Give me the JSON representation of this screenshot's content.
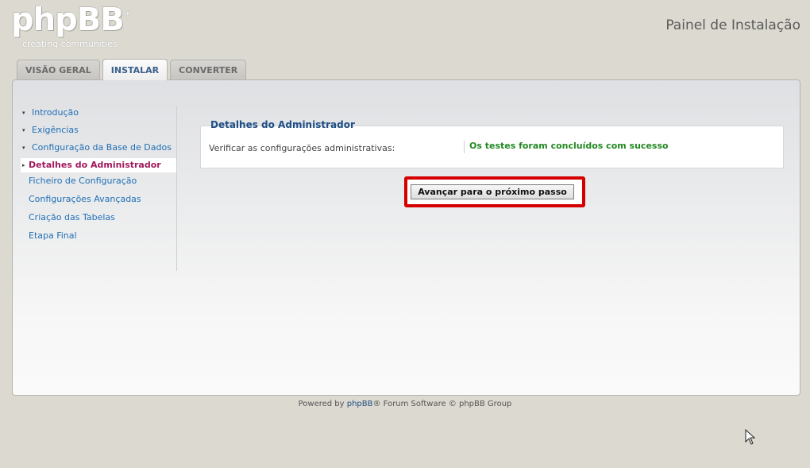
{
  "logo": {
    "name": "phpBB",
    "registered": "®",
    "tagline": "creating communities"
  },
  "header": {
    "panel_title": "Painel de Instalação"
  },
  "tabs": [
    {
      "label": "VISÃO GERAL",
      "active": false
    },
    {
      "label": "INSTALAR",
      "active": true
    },
    {
      "label": "CONVERTER",
      "active": false
    }
  ],
  "menu": {
    "items": [
      {
        "label": "Introdução"
      },
      {
        "label": "Exigências"
      },
      {
        "label": "Configuração da Base de Dados"
      },
      {
        "label": "Detalhes do Administrador"
      },
      {
        "label": "Ficheiro de Configuração"
      },
      {
        "label": "Configurações Avançadas"
      },
      {
        "label": "Criação das Tabelas"
      },
      {
        "label": "Etapa Final"
      }
    ]
  },
  "admin": {
    "legend": "Detalhes do Administrador",
    "check_label": "Verificar as configurações administrativas:",
    "check_result": "Os testes foram concluídos com sucesso"
  },
  "actions": {
    "next_label": "Avançar para o próximo passo"
  },
  "footer": {
    "prefix": "Powered by ",
    "brand": "phpBB",
    "suffix": "® Forum Software © phpBB Group"
  },
  "colors": {
    "accent": "#1e4e86",
    "active_menu": "#a0195b",
    "success": "#228822",
    "highlight": "#d40000"
  }
}
